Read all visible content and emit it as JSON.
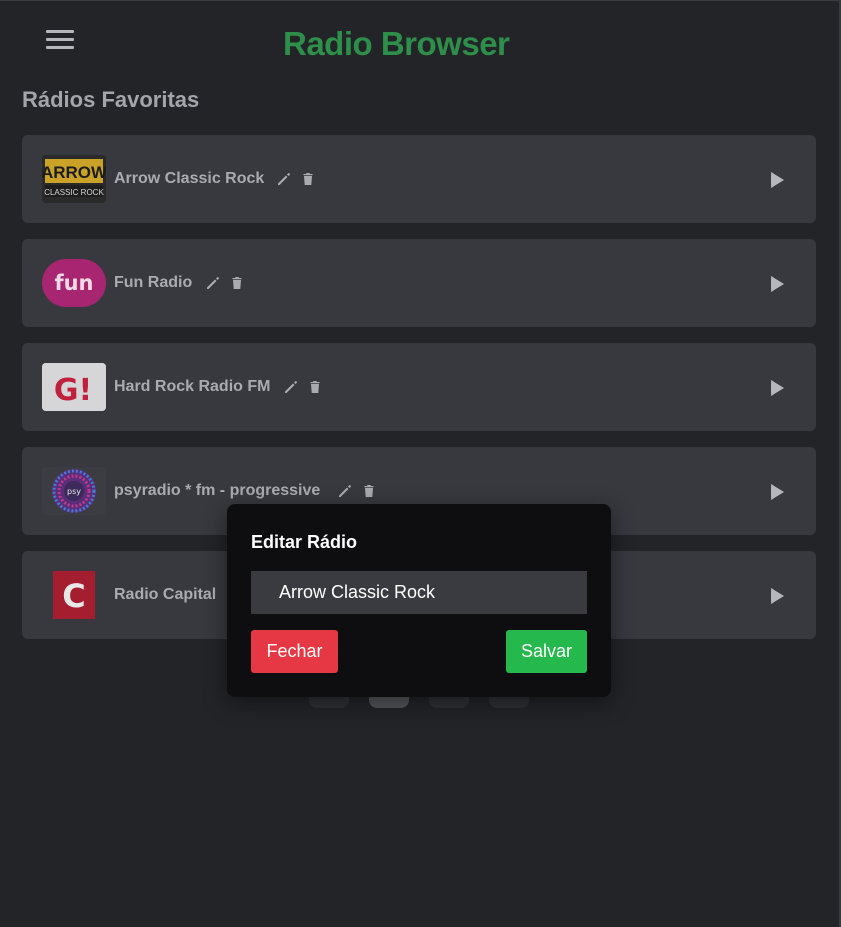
{
  "header": {
    "app_title": "Radio Browser",
    "menu_icon": "hamburger-menu-icon"
  },
  "section": {
    "title": "Rádios Favoritas"
  },
  "stations": [
    {
      "name": "Arrow Classic Rock",
      "logo_text_main": "ARROW",
      "logo_text_sub": "CLASSIC ROCK"
    },
    {
      "name": "Fun Radio",
      "logo_text_main": "fun"
    },
    {
      "name": "Hard Rock Radio FM",
      "logo_text_main": "G!"
    },
    {
      "name": "psyradio * fm - progressive",
      "logo_text_main": "psy"
    },
    {
      "name": "Radio Capital",
      "logo_text_main": "C"
    }
  ],
  "modal": {
    "title": "Editar Rádio",
    "input_value": "Arrow Classic Rock",
    "close_label": "Fechar",
    "save_label": "Salvar"
  },
  "colors": {
    "background": "#232428",
    "card": "#38393e",
    "title_green": "#2e8f4b",
    "close_red": "#e63744",
    "save_green": "#25b84c"
  }
}
